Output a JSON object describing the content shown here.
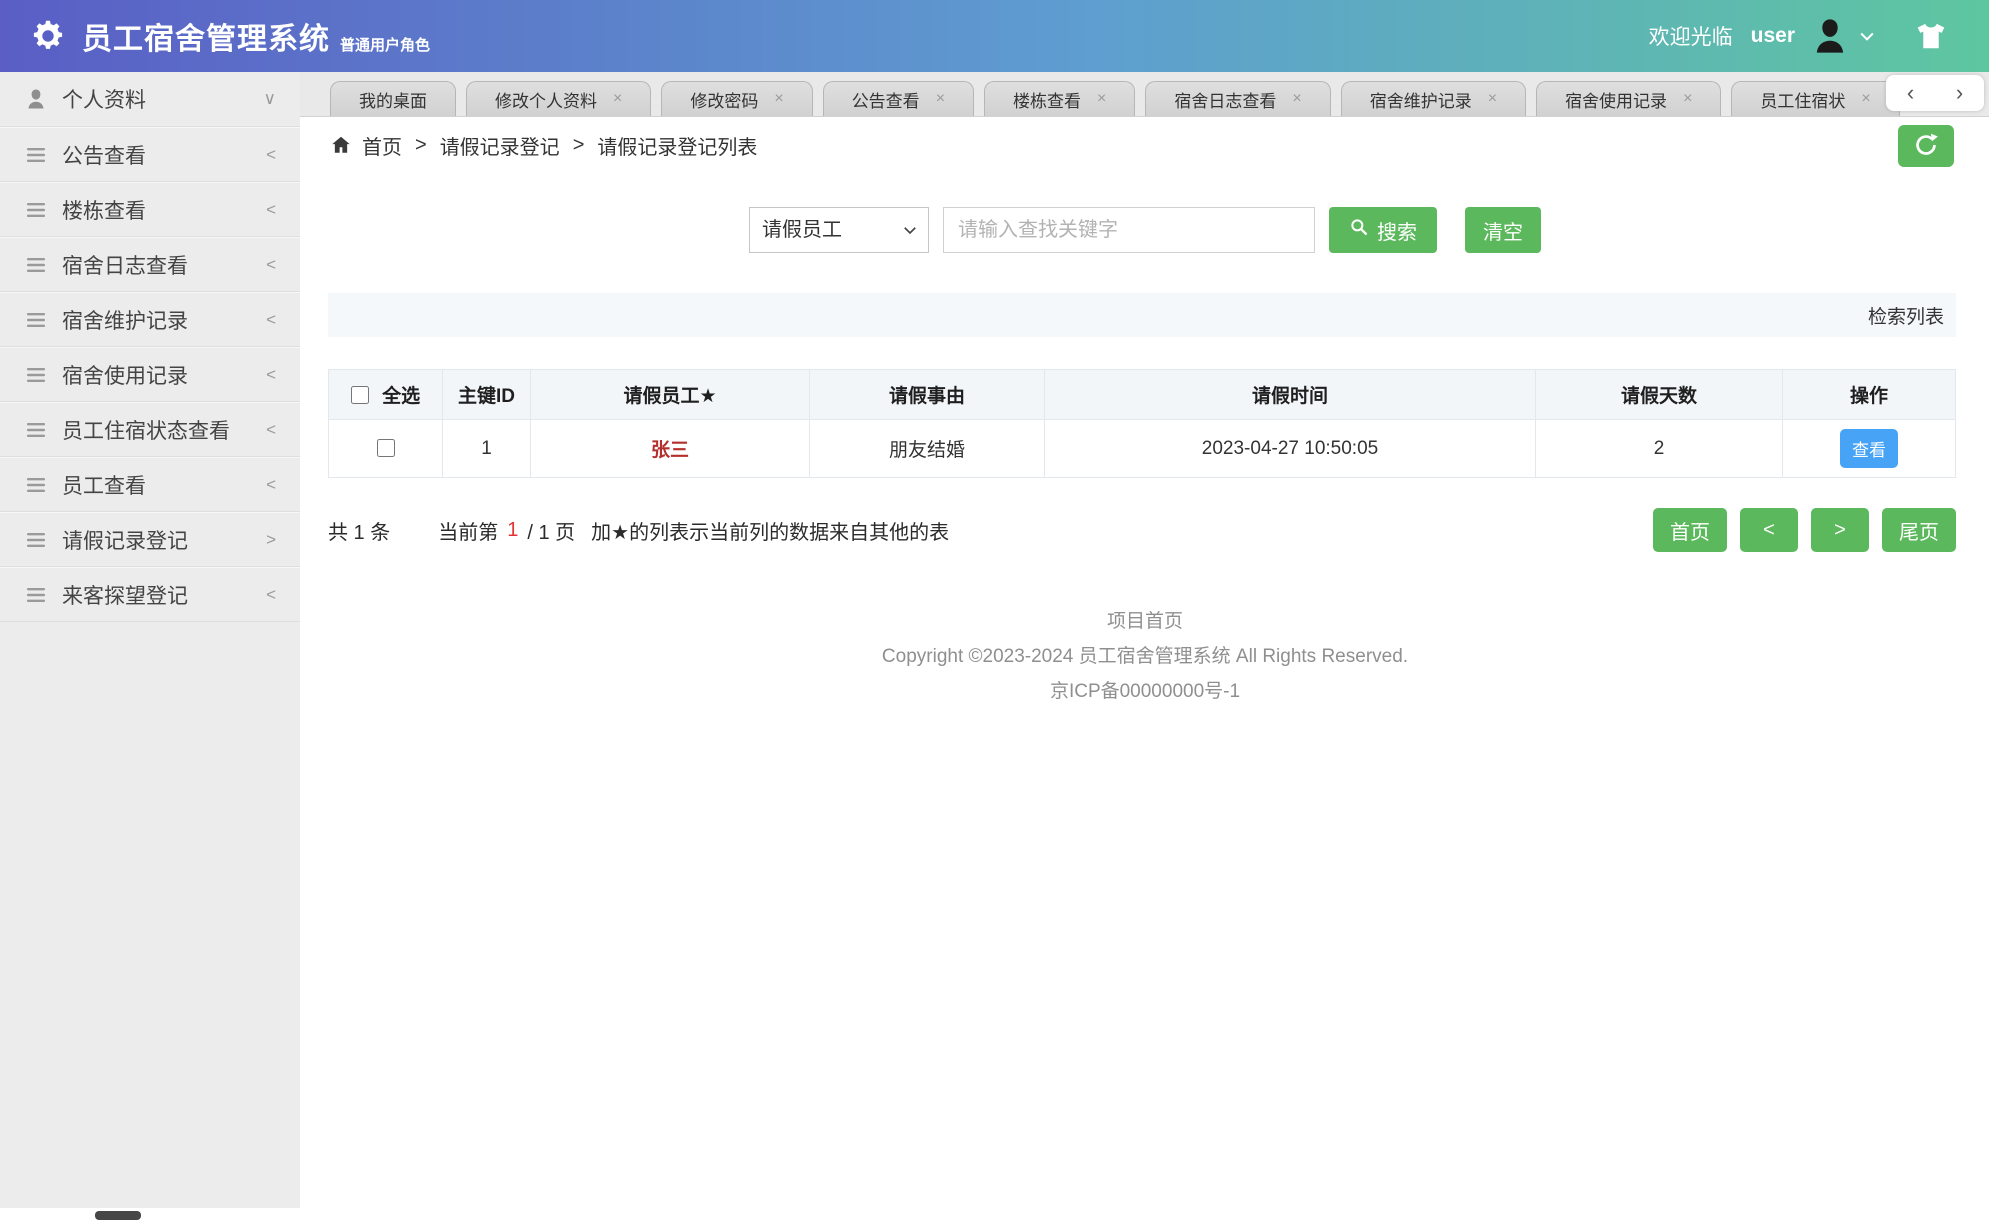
{
  "header": {
    "title": "员工宿舍管理系统",
    "subtitle": "普通用户角色",
    "welcome": "欢迎光临",
    "username": "user"
  },
  "sidebar": {
    "items": [
      {
        "label": "个人资料",
        "chev": "∨",
        "state": "expanded"
      },
      {
        "label": "公告查看",
        "chev": "<",
        "state": "collapsed"
      },
      {
        "label": "楼栋查看",
        "chev": "<",
        "state": "collapsed"
      },
      {
        "label": "宿舍日志查看",
        "chev": "<",
        "state": "collapsed"
      },
      {
        "label": "宿舍维护记录",
        "chev": "<",
        "state": "collapsed"
      },
      {
        "label": "宿舍使用记录",
        "chev": "<",
        "state": "collapsed"
      },
      {
        "label": "员工住宿状态查看",
        "chev": "<",
        "state": "collapsed"
      },
      {
        "label": "员工查看",
        "chev": "<",
        "state": "collapsed"
      },
      {
        "label": "请假记录登记",
        "chev": ">",
        "state": "active"
      },
      {
        "label": "来客探望登记",
        "chev": "<",
        "state": "collapsed"
      }
    ]
  },
  "tabs": {
    "items": [
      {
        "label": "我的桌面",
        "closable": false
      },
      {
        "label": "修改个人资料",
        "closable": true
      },
      {
        "label": "修改密码",
        "closable": true
      },
      {
        "label": "公告查看",
        "closable": true
      },
      {
        "label": "楼栋查看",
        "closable": true
      },
      {
        "label": "宿舍日志查看",
        "closable": true
      },
      {
        "label": "宿舍维护记录",
        "closable": true
      },
      {
        "label": "宿舍使用记录",
        "closable": true
      },
      {
        "label": "员工住宿状",
        "closable": true
      }
    ]
  },
  "breadcrumb": {
    "items": [
      "首页",
      "请假记录登记",
      "请假记录登记列表"
    ]
  },
  "search": {
    "filter_selected": "请假员工",
    "input_placeholder": "请输入查找关键字",
    "search_label": "搜索",
    "clear_label": "清空"
  },
  "listbar": {
    "label": "检索列表"
  },
  "table": {
    "select_all": "全选",
    "columns": [
      "主键ID",
      "请假员工★",
      "请假事由",
      "请假时间",
      "请假天数",
      "操作"
    ],
    "rows": [
      {
        "id": "1",
        "employee": "张三",
        "reason": "朋友结婚",
        "time": "2023-04-27 10:50:05",
        "days": "2",
        "action": "查看"
      }
    ]
  },
  "pagination": {
    "total": "共 1 条",
    "current_label": "当前第",
    "current_page": "1",
    "page_suffix": "/ 1 页",
    "note": "加★的列表示当前列的数据来自其他的表",
    "first": "首页",
    "prev": "<",
    "next": ">",
    "last": "尾页"
  },
  "footer": {
    "home": "项目首页",
    "copyright": "Copyright ©2023-2024 员工宿舍管理系统 All Rights Reserved.",
    "icp": "京ICP备00000000号-1"
  },
  "icons": {
    "close": "×",
    "scroll_left": "‹",
    "scroll_right": "›",
    "crumb_sep": ">"
  },
  "colors": {
    "header_gradient_start": "#5a5ec5",
    "header_gradient_mid": "#5e9ed0",
    "header_gradient_end": "#5ec6a0",
    "green": "#5cb85c",
    "blue": "#47a3f5",
    "link_red": "#b4302c",
    "page_red": "#e53333",
    "sidebar_bg": "#ececec"
  }
}
